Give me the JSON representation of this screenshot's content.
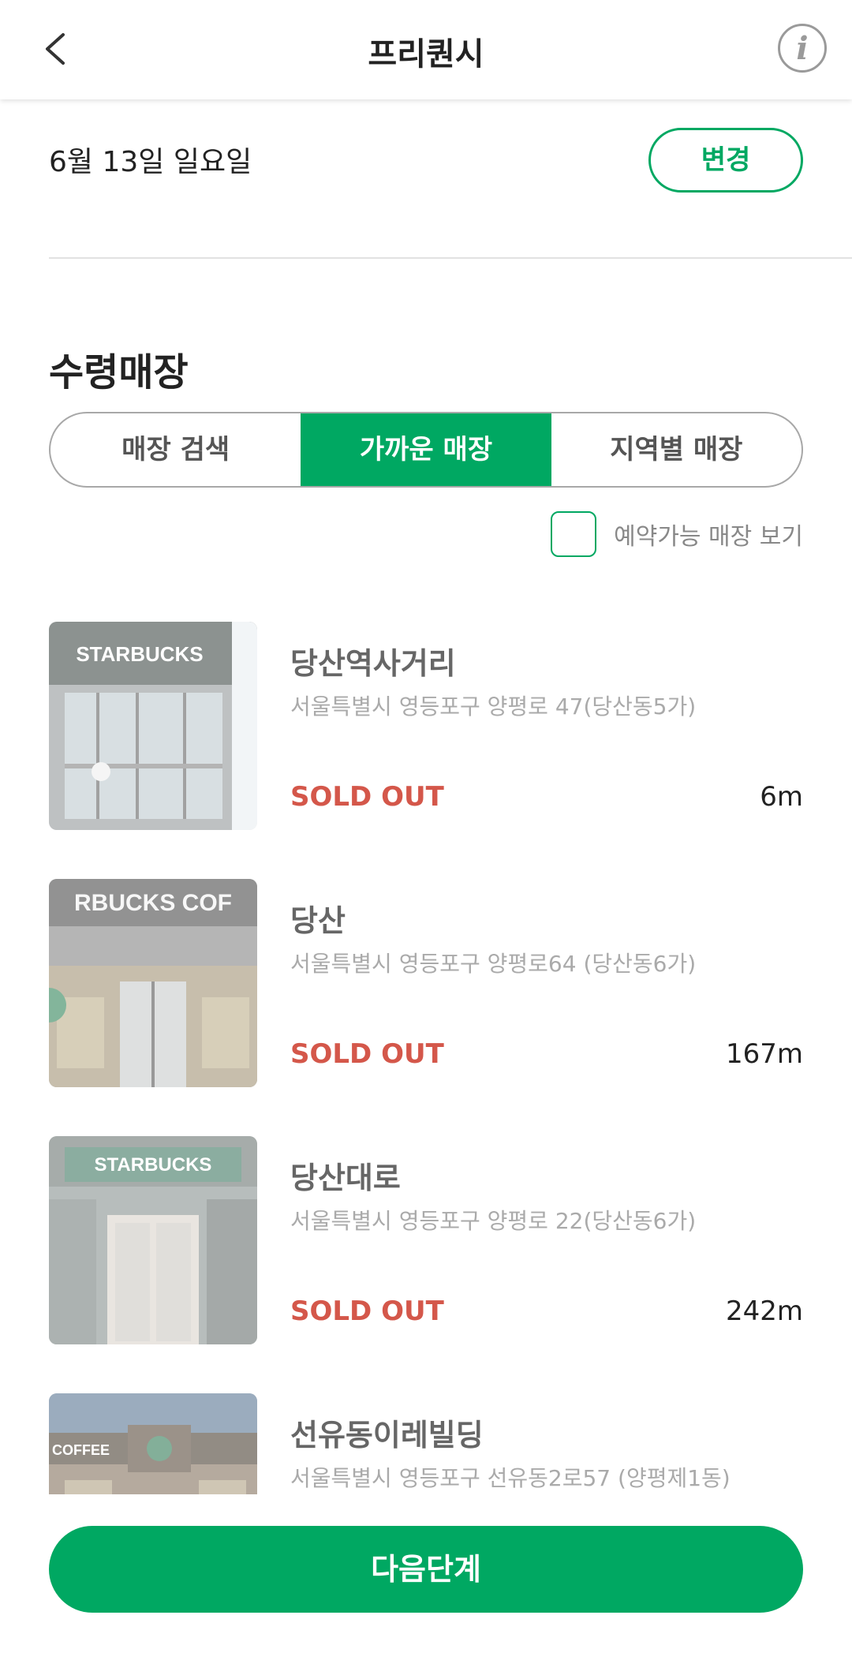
{
  "header": {
    "title": "프리퀀시",
    "info_label": "i"
  },
  "date": {
    "text": "6월 13일 일요일",
    "change_label": "변경"
  },
  "section": {
    "title": "수령매장"
  },
  "tabs": [
    {
      "label": "매장 검색",
      "active": false
    },
    {
      "label": "가까운 매장",
      "active": true
    },
    {
      "label": "지역별 매장",
      "active": false
    }
  ],
  "filter": {
    "label": "예약가능 매장 보기",
    "checked": false
  },
  "stores": [
    {
      "name": "당산역사거리",
      "address": "서울특별시 영등포구 양평로 47(당산동5가)",
      "status": "SOLD OUT",
      "distance": "6m",
      "sign_text": "STARBUCKS"
    },
    {
      "name": "당산",
      "address": "서울특별시 영등포구 양평로64 (당산동6가)",
      "status": "SOLD OUT",
      "distance": "167m",
      "sign_text": "RBUCKS COF"
    },
    {
      "name": "당산대로",
      "address": "서울특별시 영등포구 양평로 22(당산동6가)",
      "status": "SOLD OUT",
      "distance": "242m",
      "sign_text": "STARBUCKS"
    },
    {
      "name": "선유동이레빌딩",
      "address": "서울특별시 영등포구 선유동2로57 (양평제1동)",
      "status": "",
      "distance": "",
      "sign_text": "COFFEE"
    }
  ],
  "footer": {
    "next_label": "다음단계"
  },
  "colors": {
    "accent": "#00a862",
    "sold_out": "#d4574a"
  }
}
